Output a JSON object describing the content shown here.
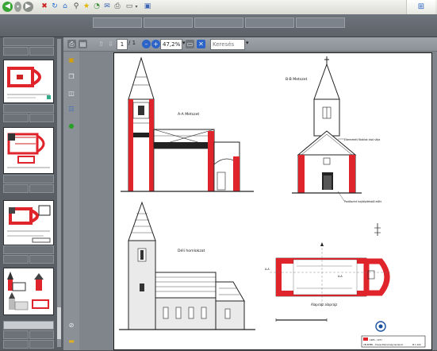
{
  "toolbar": {
    "page_current": "1",
    "page_total": "/ 1",
    "zoom": "47,2%",
    "search_placeholder": "Keresés"
  },
  "icons": [
    "back-icon",
    "forward-icon",
    "stop-icon",
    "refresh-icon",
    "home-icon",
    "search-icon",
    "favorites-icon",
    "history-icon",
    "mail-icon",
    "print-icon",
    "edit-icon",
    "windows-logo-icon",
    "print-icon",
    "save-icon",
    "prev-page-icon",
    "next-page-icon",
    "zoom-out-icon",
    "zoom-in-icon",
    "fit-page-icon",
    "select-icon",
    "lock-icon",
    "pages-icon",
    "layers-icon",
    "attachment-icon",
    "comment-icon"
  ],
  "drawing": {
    "sections": [
      "A-A Metszet",
      "B-B Metszet",
      "Déli homlokzat",
      "Alaprajz"
    ],
    "floor_plan_caption": "Alaprajz alaprajz",
    "callout_top": "Eltemetett főablak alsó síkja",
    "callout_bottom": "Padlószint hajóépítésből előtt",
    "section_marks": [
      "A-A",
      "A-A"
    ],
    "title_block": "VELEMÉR - Őrszentháromság templom",
    "title_year": "1985 - 1977",
    "scale": "M 1:100"
  },
  "colors": {
    "wall_red": "#e0242b",
    "page_bg": "#ffffff",
    "viewer_bg": "#7f858b"
  }
}
